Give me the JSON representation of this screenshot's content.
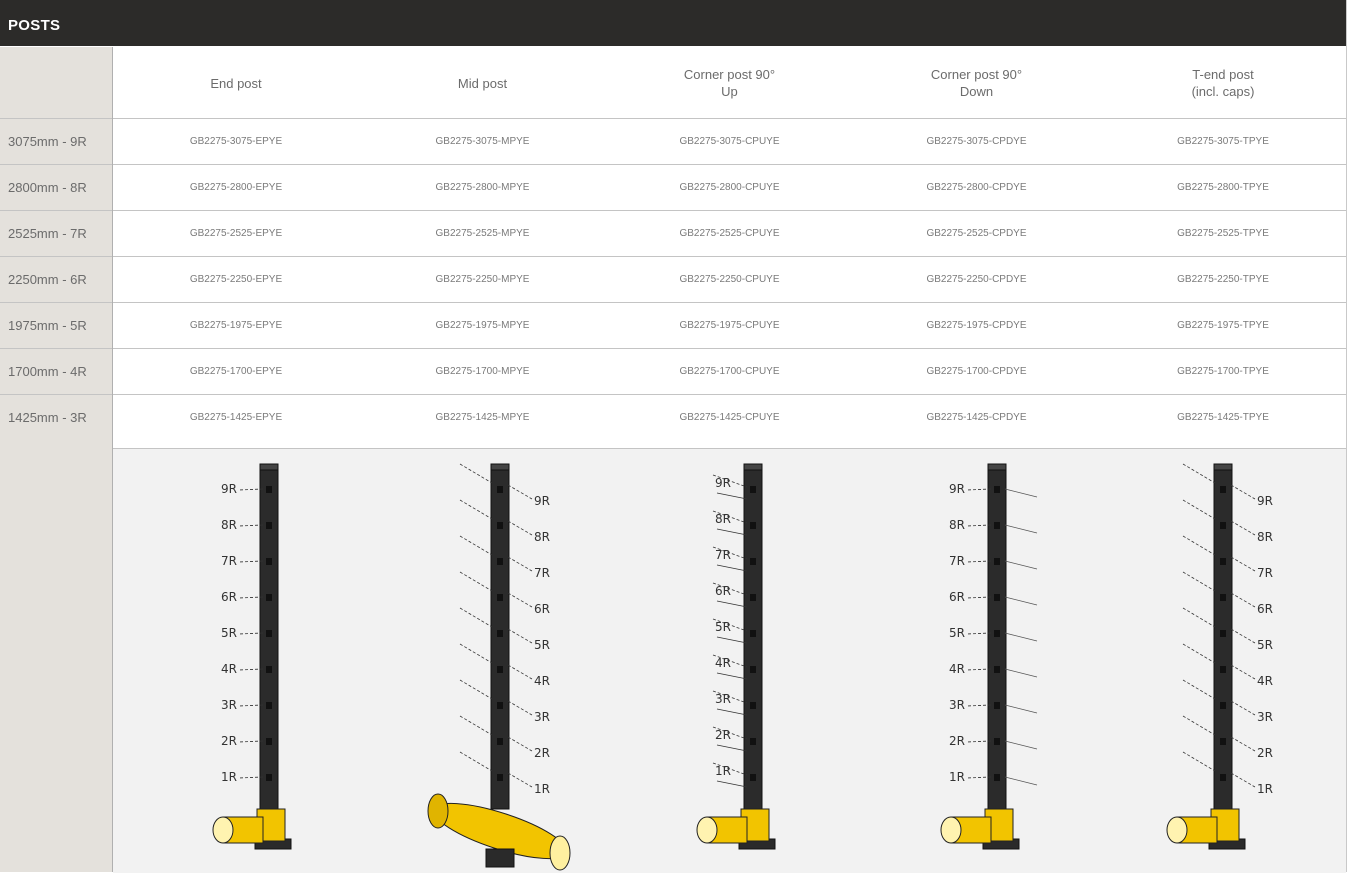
{
  "header": {
    "title": "POSTS"
  },
  "columns": [
    "End post",
    "Mid post",
    "Corner post 90°\nUp",
    "Corner post 90°\nDown",
    "T-end post\n(incl. caps)"
  ],
  "rows": [
    {
      "size": "3075mm - 9R",
      "codes": [
        "GB2275-3075-EPYE",
        "GB2275-3075-MPYE",
        "GB2275-3075-CPUYE",
        "GB2275-3075-CPDYE",
        "GB2275-3075-TPYE"
      ]
    },
    {
      "size": "2800mm - 8R",
      "codes": [
        "GB2275-2800-EPYE",
        "GB2275-2800-MPYE",
        "GB2275-2800-CPUYE",
        "GB2275-2800-CPDYE",
        "GB2275-2800-TPYE"
      ]
    },
    {
      "size": "2525mm - 7R",
      "codes": [
        "GB2275-2525-EPYE",
        "GB2275-2525-MPYE",
        "GB2275-2525-CPUYE",
        "GB2275-2525-CPDYE",
        "GB2275-2525-TPYE"
      ]
    },
    {
      "size": "2250mm - 6R",
      "codes": [
        "GB2275-2250-EPYE",
        "GB2275-2250-MPYE",
        "GB2275-2250-CPUYE",
        "GB2275-2250-CPDYE",
        "GB2275-2250-TPYE"
      ]
    },
    {
      "size": "1975mm - 5R",
      "codes": [
        "GB2275-1975-EPYE",
        "GB2275-1975-MPYE",
        "GB2275-1975-CPUYE",
        "GB2275-1975-CPDYE",
        "GB2275-1975-TPYE"
      ]
    },
    {
      "size": "1700mm - 4R",
      "codes": [
        "GB2275-1700-EPYE",
        "GB2275-1700-MPYE",
        "GB2275-1700-CPUYE",
        "GB2275-1700-CPDYE",
        "GB2275-1700-TPYE"
      ]
    },
    {
      "size": "1425mm - 3R",
      "codes": [
        "GB2275-1425-EPYE",
        "GB2275-1425-MPYE",
        "GB2275-1425-CPUYE",
        "GB2275-1425-CPDYE",
        "GB2275-1425-TPYE"
      ]
    }
  ],
  "drawings": {
    "rail_labels": [
      "9R",
      "8R",
      "7R",
      "6R",
      "5R",
      "4R",
      "3R",
      "2R",
      "1R"
    ],
    "post_color": "#2b2b2b",
    "base_color": "#f2c400"
  },
  "colors": {
    "header_bg": "#2c2b29",
    "label_col_bg": "#e4e1dc",
    "image_bg": "#f2f2f2"
  }
}
